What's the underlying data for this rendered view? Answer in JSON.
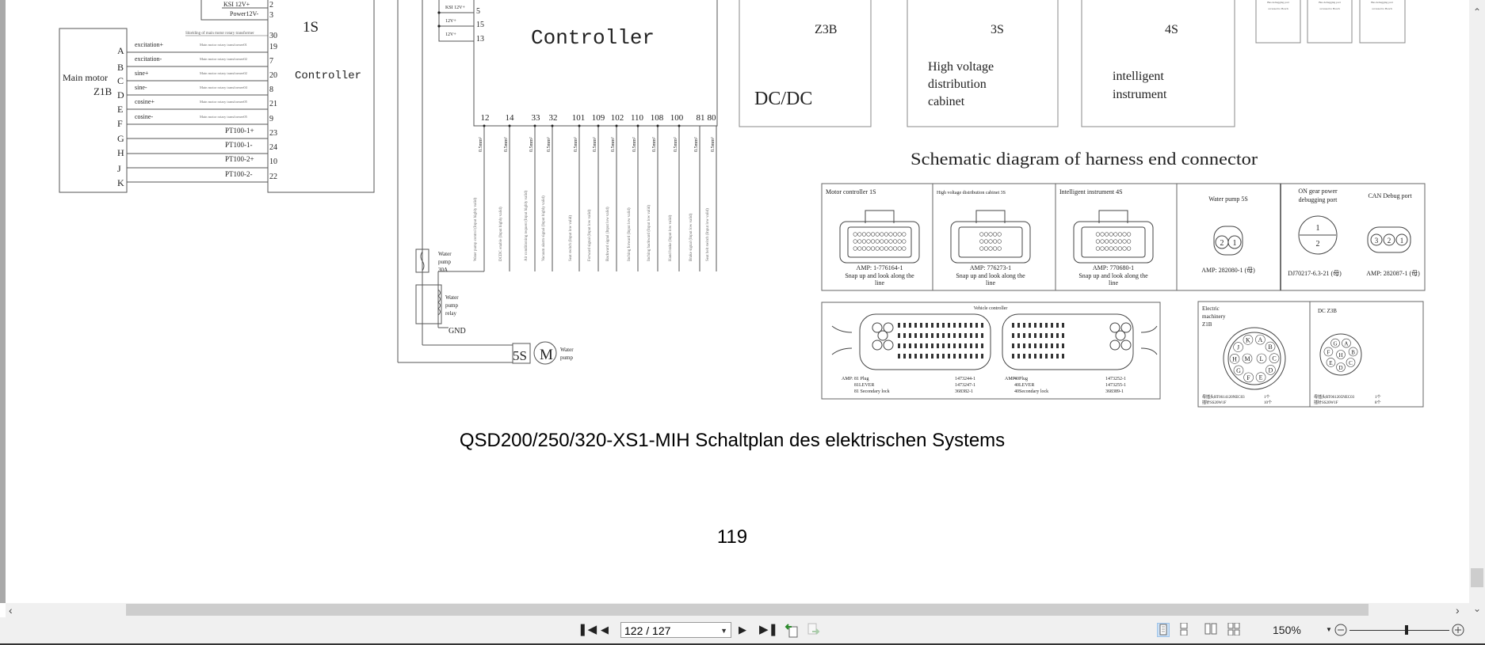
{
  "document": {
    "title": "QSD200/250/320-XS1-MIH Schaltplan des elektrischen Systems",
    "page_number": "119",
    "top_box": {
      "labels": [
        "KSI 12V+",
        "Power12V-"
      ],
      "pins": [
        "2",
        "3"
      ]
    },
    "main_motor": {
      "name": "Main motor",
      "connector": "Z1B",
      "shield_label": "Shielding of main motor rotary transformer",
      "shield_pin": "30",
      "rows": [
        {
          "letter": "A",
          "signal": "excitation+",
          "cable": "Main motor rotary transformer01",
          "pin": "19"
        },
        {
          "letter": "B",
          "signal": "excitation-",
          "cable": "Main motor rotary transformer02",
          "pin": "7"
        },
        {
          "letter": "C",
          "signal": "sine+",
          "cable": "Main motor rotary transformer02",
          "pin": "20"
        },
        {
          "letter": "D",
          "signal": "sine-",
          "cable": "Main motor rotary transformer04",
          "pin": "8"
        },
        {
          "letter": "E",
          "signal": "cosine+",
          "cable": "Main motor rotary transformer05",
          "pin": "21"
        },
        {
          "letter": "F",
          "signal": "cosine-",
          "cable": "Main motor rotary transformer05",
          "pin": "9"
        },
        {
          "letter": "G",
          "signal": "PT100-1+",
          "cable": "",
          "pin": "23"
        },
        {
          "letter": "H",
          "signal": "PT100-1-",
          "cable": "",
          "pin": "24"
        },
        {
          "letter": "J",
          "signal": "PT100-2+",
          "cable": "",
          "pin": "10"
        },
        {
          "letter": "K",
          "signal": "PT100-2-",
          "cable": "",
          "pin": "22"
        }
      ]
    },
    "controller_1s": {
      "id": "1S",
      "name": "Controller"
    },
    "controller": {
      "name": "Controller",
      "supply": [
        {
          "label": "KSI 12V+",
          "pin": "5"
        },
        {
          "label": "12V+",
          "pin": "15"
        },
        {
          "label": "12V+",
          "pin": "13"
        }
      ],
      "wires": [
        {
          "pin": "12",
          "gauge": "0.5mm²",
          "label": "Water pump control (Input highly valid)"
        },
        {
          "pin": "14",
          "gauge": "0.5mm²",
          "label": "DCDC enable (Input highly valid)"
        },
        {
          "pin": "33",
          "gauge": "0.5mm²",
          "label": "Air conditioning request (Input highly valid)"
        },
        {
          "pin": "32",
          "gauge": "0.5mm²",
          "label": "Vacuum alarm signal (Input highly valid)"
        },
        {
          "pin": "101",
          "gauge": "0.5mm²",
          "label": "Seat switch (Input low valid)"
        },
        {
          "pin": "109",
          "gauge": "0.5mm²",
          "label": "Forward signal (Input low valid)"
        },
        {
          "pin": "102",
          "gauge": "0.5mm²",
          "label": "Backward signal (Input low valid)"
        },
        {
          "pin": "110",
          "gauge": "0.5mm²",
          "label": "Inching forward (Input low valid)"
        },
        {
          "pin": "108",
          "gauge": "0.5mm²",
          "label": "Inching backward (Input low valid)"
        },
        {
          "pin": "100",
          "gauge": "0.5mm²",
          "label": "Hand brake (Input low valid)"
        },
        {
          "pin": "81",
          "gauge": "0.5mm²",
          "label": "Brake signal (Input low valid)"
        },
        {
          "pin": "80",
          "gauge": "0.5mm²",
          "label": "Seat belt switch (Input low valid)"
        }
      ]
    },
    "water_pump": {
      "fuse": [
        "Water",
        "pump",
        "30A"
      ],
      "relay": [
        "Water",
        "pump",
        "relay"
      ],
      "gnd": "GND",
      "id": "5S",
      "motor_symbol": "M",
      "label": [
        "Water",
        "pump"
      ]
    },
    "modules": [
      {
        "id": "Z3B",
        "lines": [
          "DC/DC"
        ]
      },
      {
        "id": "3S",
        "lines": [
          "High voltage",
          "distribution",
          "cabinet"
        ]
      },
      {
        "id": "4S",
        "lines": [
          "intelligent",
          "instrument"
        ]
      }
    ],
    "small_boxes": [
      [
        "Bus debugging port",
        "accessed to Bosch"
      ],
      [
        "Bus debugging port",
        "accessed to Bosch"
      ],
      [
        "Bus debugging port",
        "accessed to Bosch"
      ]
    ],
    "connector_section_title": "Schematic diagram of harness end connector",
    "connectors": [
      {
        "title": "Motor controller  1S",
        "amp": "AMP: 1-776164-1",
        "note": [
          "Snap up and look along the",
          "line"
        ]
      },
      {
        "title": "High voltage distribution cabinet   3S",
        "amp": "AMP: 776273-1",
        "note": [
          "Snap up and look along the",
          "line"
        ]
      },
      {
        "title": "Intelligent instrument  4S",
        "amp": "AMP: 770680-1",
        "note": [
          "Snap up and look along the",
          "line"
        ]
      },
      {
        "title": "Water pump 5S",
        "amp": "AMP: 282080-1 (母)",
        "pins": [
          "2",
          "1"
        ]
      },
      {
        "title": [
          "ON gear power",
          "debugging port"
        ],
        "amp": "DJ70217-6.3-21 (母)",
        "pins": [
          "1",
          "2"
        ]
      },
      {
        "title": "CAN Debug port",
        "amp": "AMP: 282087-1 (母)",
        "pins": [
          "3",
          "2",
          "1"
        ]
      }
    ],
    "vehicle_controller": {
      "title": "Vehicle controller",
      "left": {
        "amp": "AMP:",
        "rows": [
          [
            "81 Plug",
            "1473244-1"
          ],
          [
            "81LEVER",
            "1473247-1"
          ],
          [
            "81 Secondary lock",
            "368382-1"
          ]
        ]
      },
      "right": {
        "amp": "AMP:",
        "rows": [
          [
            "40Plug",
            "1473252-1"
          ],
          [
            "40LEVER",
            "1473255-1"
          ],
          [
            "40Secondary lock",
            "368389-1"
          ]
        ]
      }
    },
    "electric_machinery": {
      "title": [
        "Electric",
        "machinery",
        "Z1B"
      ],
      "pins": [
        "A",
        "B",
        "C",
        "D",
        "E",
        "F",
        "G",
        "H",
        "J",
        "K",
        "L",
        "M"
      ],
      "parts": [
        [
          "母插头RT0614120NEC03",
          "1个"
        ],
        [
          "插针SS20W1F",
          "10个"
        ]
      ]
    },
    "dc_z3b": {
      "title": "DC  Z3B",
      "pins": [
        "A",
        "B",
        "C",
        "D",
        "E",
        "F",
        "G",
        "H"
      ],
      "parts": [
        [
          "母插头RT061205NEC03",
          "1个"
        ],
        [
          "插针SS20W1F",
          "8个"
        ]
      ]
    }
  },
  "toolbar": {
    "page_field": "122 / 127",
    "zoom_level": "150%",
    "zoom_slider_fraction": 0.57
  },
  "scrollbars": {
    "vertical_position_fraction": 0.96,
    "horizontal_position_fraction": 0.0
  }
}
